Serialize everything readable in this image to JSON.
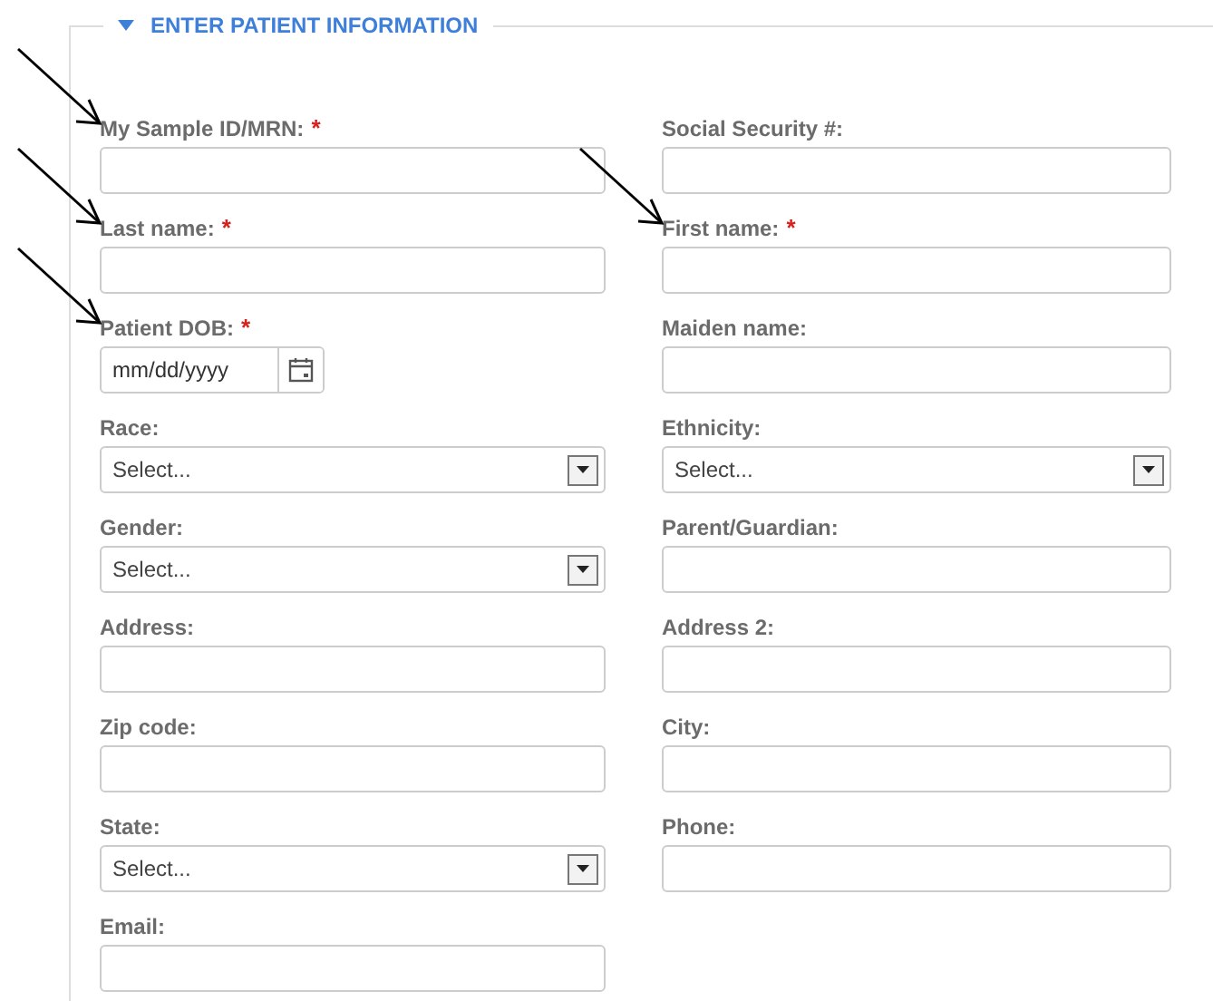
{
  "section": {
    "title": "ENTER PATIENT INFORMATION",
    "expanded": true
  },
  "rows": [
    [
      {
        "label": "My Sample ID/MRN:",
        "required_mark": "*",
        "kind": "text",
        "pointed": true
      },
      {
        "label": "Social Security #:",
        "kind": "text",
        "pointed": false
      }
    ],
    [
      {
        "label": "Last name:",
        "required_mark": "*",
        "kind": "text",
        "pointed": true
      },
      {
        "label": "First name:",
        "required_mark": "*",
        "kind": "text",
        "pointed": true
      }
    ],
    [
      {
        "label": "Patient DOB:",
        "required_mark": "*",
        "kind": "date",
        "placeholder": "mm/dd/yyyy",
        "pointed": true
      },
      {
        "label": "Maiden name:",
        "kind": "text",
        "pointed": false
      }
    ],
    [
      {
        "label": "Race:",
        "kind": "select",
        "value": "Select...",
        "pointed": false
      },
      {
        "label": "Ethnicity:",
        "kind": "select",
        "value": "Select...",
        "pointed": false
      }
    ],
    [
      {
        "label": "Gender:",
        "kind": "select",
        "value": "Select...",
        "pointed": false
      },
      {
        "label": "Parent/Guardian:",
        "kind": "text",
        "pointed": false
      }
    ],
    [
      {
        "label": "Address:",
        "kind": "text",
        "pointed": false
      },
      {
        "label": "Address 2:",
        "kind": "text",
        "pointed": false
      }
    ],
    [
      {
        "label": "Zip code:",
        "kind": "text",
        "pointed": false
      },
      {
        "label": "City:",
        "kind": "text",
        "pointed": false
      }
    ],
    [
      {
        "label": "State:",
        "kind": "select",
        "value": "Select...",
        "pointed": false
      },
      {
        "label": "Phone:",
        "kind": "text",
        "pointed": false
      }
    ],
    [
      {
        "label": "Email:",
        "kind": "text",
        "pointed": false
      }
    ]
  ]
}
